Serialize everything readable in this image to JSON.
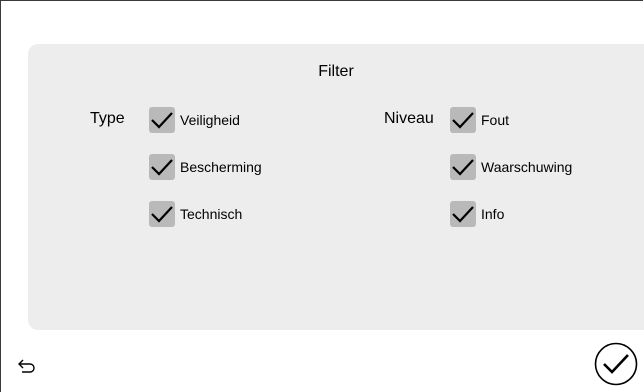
{
  "panel": {
    "title": "Filter"
  },
  "type_group": {
    "label": "Type",
    "options": [
      {
        "label": "Veiligheid",
        "checked": true
      },
      {
        "label": "Bescherming",
        "checked": true
      },
      {
        "label": "Technisch",
        "checked": true
      }
    ]
  },
  "level_group": {
    "label": "Niveau",
    "options": [
      {
        "label": "Fout",
        "checked": true
      },
      {
        "label": "Waarschuwing",
        "checked": true
      },
      {
        "label": "Info",
        "checked": true
      }
    ]
  },
  "footer": {
    "back_icon": "undo-arrow-icon",
    "confirm_icon": "checkmark-circle-icon"
  },
  "colors": {
    "panel": "#ededed",
    "checkbox": "#b9b9b9"
  }
}
